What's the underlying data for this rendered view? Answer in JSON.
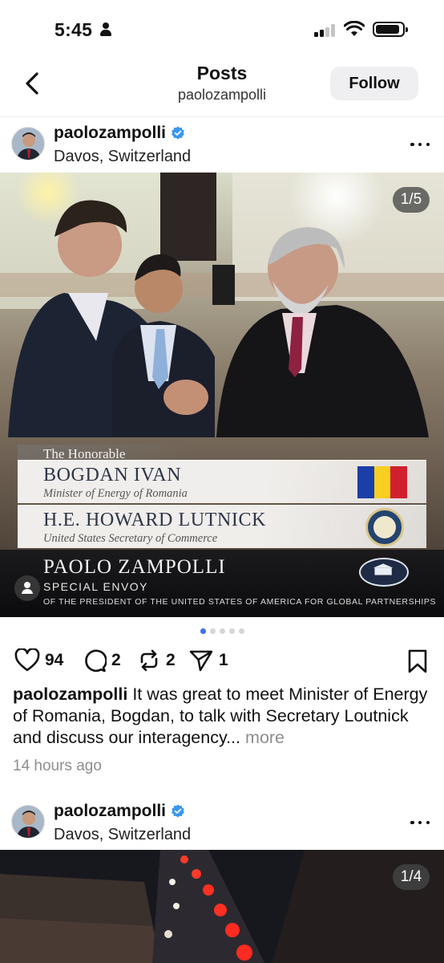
{
  "status_bar": {
    "time": "5:45"
  },
  "nav": {
    "title": "Posts",
    "subtitle": "paolozampolli",
    "follow_label": "Follow"
  },
  "posts": [
    {
      "username": "paolozampolli",
      "location": "Davos, Switzerland",
      "counter": "1/5",
      "overlay": {
        "honorable": "The Honorable",
        "rows": [
          {
            "name": "BOGDAN IVAN",
            "role": "Minister of Energy of Romania"
          },
          {
            "name": "H.E. HOWARD LUTNICK",
            "role": "United States Secretary of Commerce"
          }
        ],
        "envoy_name": "PAOLO ZAMPOLLI",
        "envoy_title": "SPECIAL ENVOY",
        "envoy_desc": "OF THE PRESIDENT OF THE UNITED STATES OF AMERICA FOR GLOBAL PARTNERSHIPS"
      },
      "carousel": {
        "total": 5,
        "active": 1
      },
      "likes": "94",
      "comments": "2",
      "reposts": "2",
      "shares": "1",
      "caption_text": "It was great to meet Minister of Energy of Romania, Bogdan, to talk with Secretary Loutnick  and discuss our interagency...",
      "more_label": "more",
      "timestamp": "14 hours ago"
    },
    {
      "username": "paolozampolli",
      "location": "Davos, Switzerland",
      "counter": "1/4"
    }
  ],
  "colors": {
    "accent_blue": "#3a6ff2",
    "verified_blue": "#3897f0",
    "muted": "#8e8e8e",
    "flag_ro": [
      "#1b3ea8",
      "#f6cf20",
      "#d0202e"
    ]
  }
}
